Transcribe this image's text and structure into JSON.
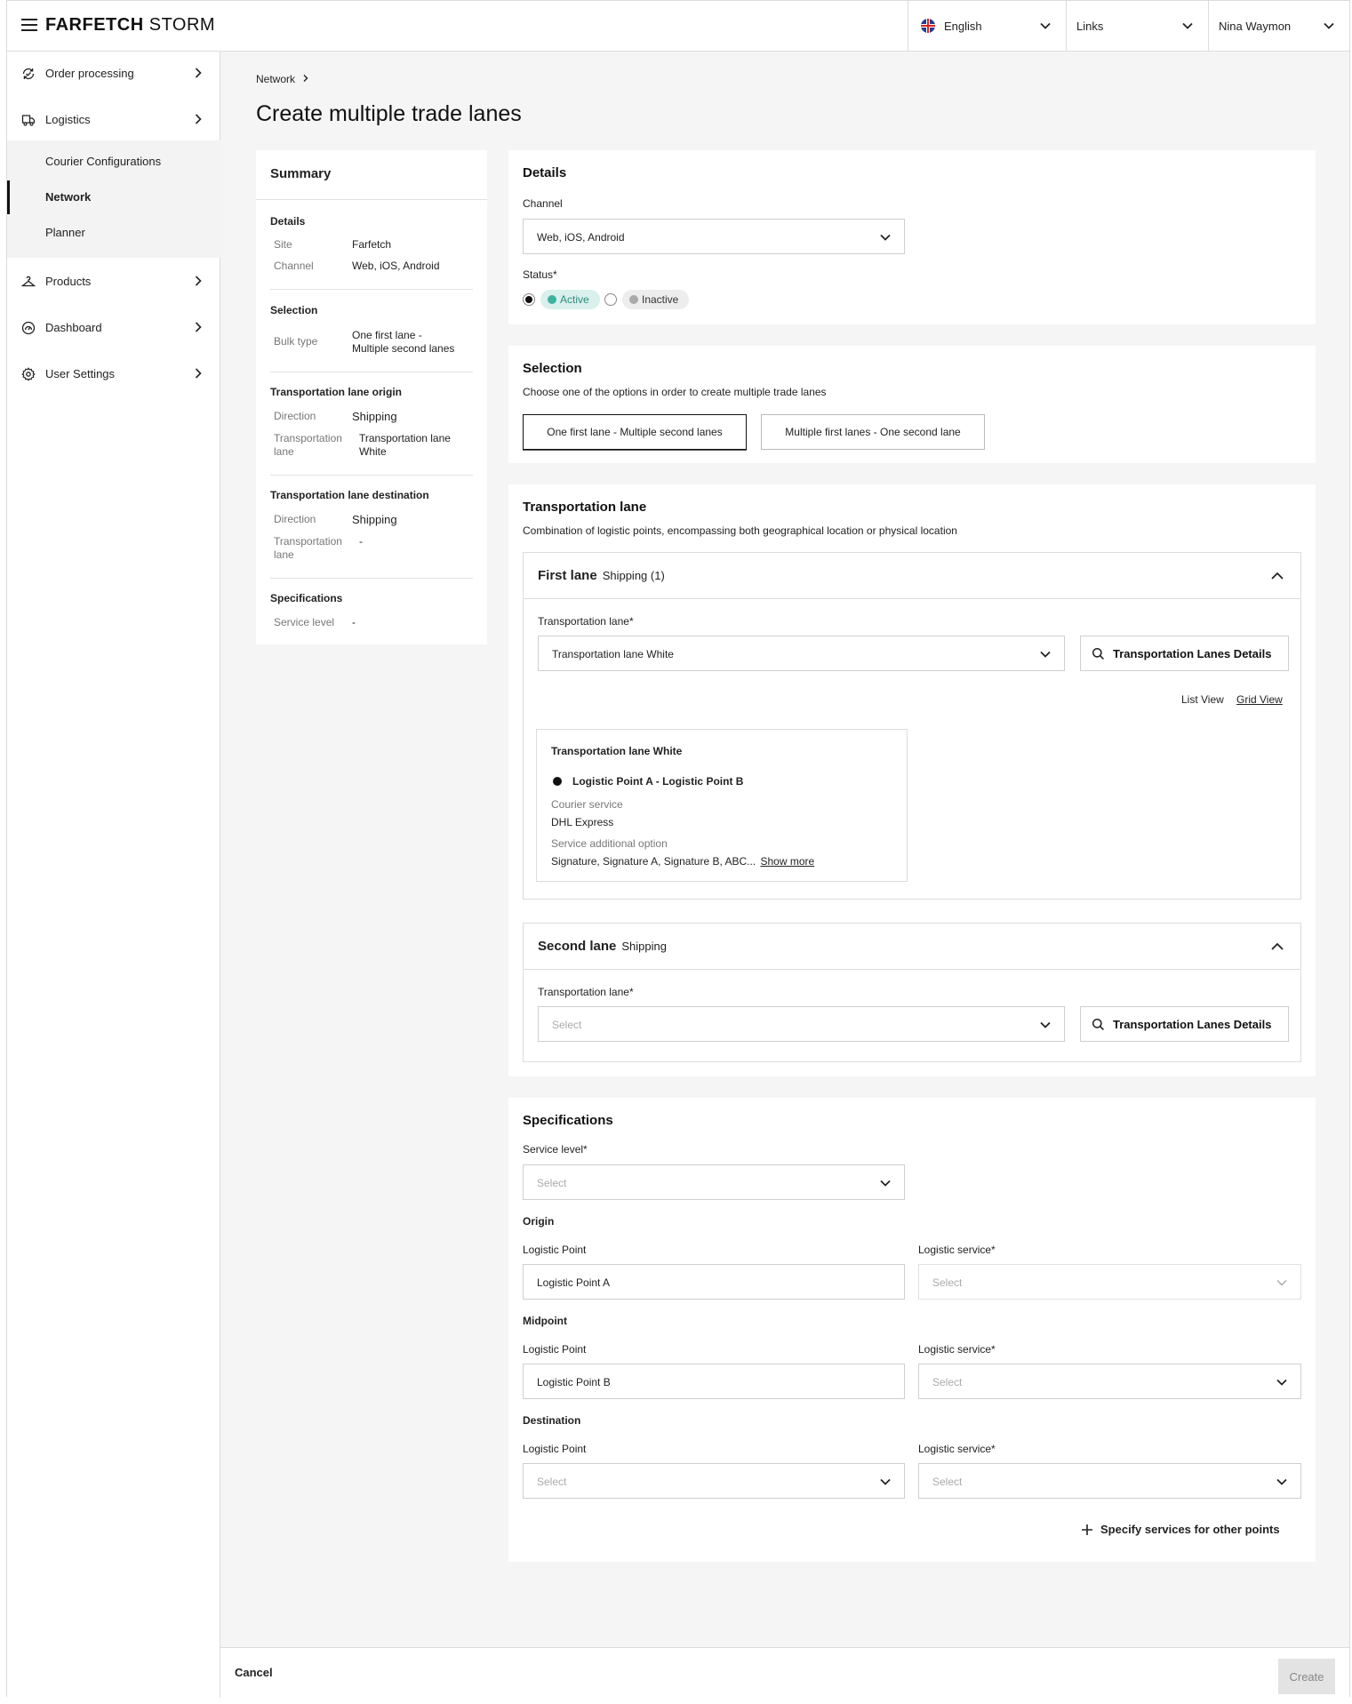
{
  "header": {
    "brand_bold": "FARFETCH",
    "brand_light": "STORM",
    "language": "English",
    "links": "Links",
    "user": "Nina Waymon"
  },
  "sidebar": {
    "items": [
      {
        "label": "Order processing",
        "icon": "order-processing-icon"
      },
      {
        "label": "Logistics",
        "icon": "truck-icon"
      },
      {
        "label": "Products",
        "icon": "hanger-icon"
      },
      {
        "label": "Dashboard",
        "icon": "gauge-icon"
      },
      {
        "label": "User Settings",
        "icon": "gear-icon"
      }
    ],
    "subitems": [
      "Courier Configurations",
      "Network",
      "Planner"
    ]
  },
  "breadcrumb": "Network",
  "page_title": "Create multiple trade lanes",
  "summary": {
    "title": "Summary",
    "details": {
      "title": "Details",
      "site_k": "Site",
      "site_v": "Farfetch",
      "channel_k": "Channel",
      "channel_v": "Web, iOS, Android"
    },
    "selection": {
      "title": "Selection",
      "bulk_k": "Bulk type",
      "bulk_v1": "One first lane -",
      "bulk_v2": "Multiple second lanes"
    },
    "origin": {
      "title": "Transportation lane origin",
      "dir_k": "Direction",
      "dir_v": "Shipping",
      "lane_k1": "Transportation",
      "lane_k2": "lane",
      "lane_v1": "Transportation lane",
      "lane_v2": "White"
    },
    "destination": {
      "title": "Transportation lane destination",
      "dir_k": "Direction",
      "dir_v": "Shipping",
      "lane_k1": "Transportation",
      "lane_k2": "lane",
      "lane_v": "-"
    },
    "specs": {
      "title": "Specifications",
      "service_k": "Service level",
      "service_v": "-"
    }
  },
  "details": {
    "title": "Details",
    "channel_label": "Channel",
    "channel_value": "Web, iOS, Android",
    "status_label": "Status*",
    "active": "Active",
    "inactive": "Inactive"
  },
  "selection": {
    "title": "Selection",
    "desc": "Choose one of the options in order to create multiple trade lanes",
    "opt1": "One first lane - Multiple second lanes",
    "opt2": "Multiple first lanes - One second lane"
  },
  "transport": {
    "title": "Transportation lane",
    "desc": "Combination of logistic points, encompassing both geographical location or physical location",
    "first": {
      "title": "First lane",
      "sub": "Shipping (1)",
      "field_label": "Transportation lane*",
      "value": "Transportation lane White",
      "details_btn": "Transportation Lanes Details",
      "list_view": "List View",
      "grid_view": "Grid View",
      "card": {
        "title": "Transportation lane White",
        "route": "Logistic Point A - Logistic Point B",
        "courier_k": "Courier service",
        "courier_v": "DHL Express",
        "add_k": "Service additional option",
        "add_v": "Signature, Signature A, Signature B, ABC...",
        "show_more": "Show more"
      }
    },
    "second": {
      "title": "Second lane",
      "sub": "Shipping",
      "field_label": "Transportation lane*",
      "placeholder": "Select",
      "details_btn": "Transportation Lanes Details"
    }
  },
  "specs": {
    "title": "Specifications",
    "service_label": "Service level*",
    "placeholder": "Select",
    "origin": "Origin",
    "midpoint": "Midpoint",
    "destination": "Destination",
    "lp_label": "Logistic Point",
    "ls_label": "Logistic service*",
    "origin_lp": "Logistic Point A",
    "midpoint_lp": "Logistic Point B",
    "add_more": "Specify services for other points"
  },
  "footer": {
    "cancel": "Cancel",
    "create": "Create"
  }
}
